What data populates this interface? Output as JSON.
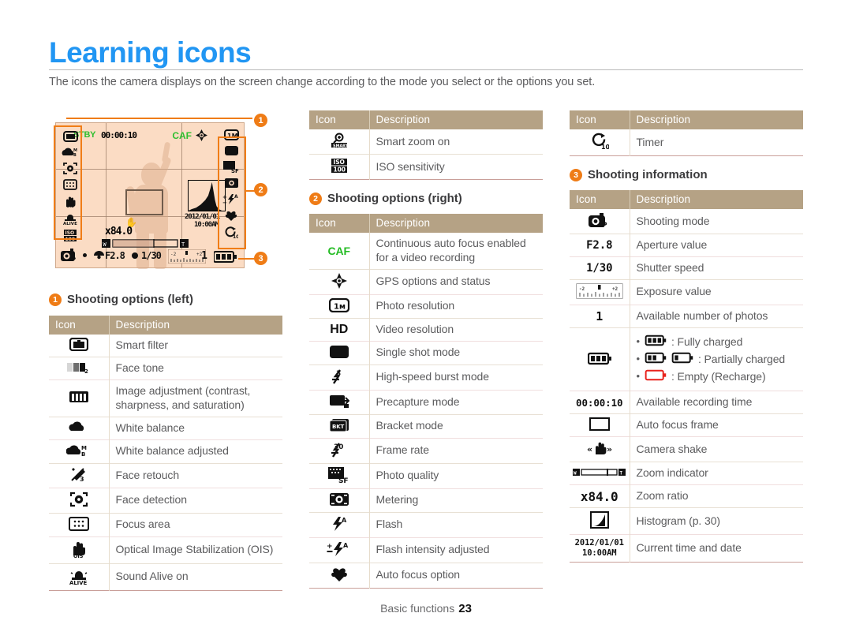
{
  "header": {
    "title": "Learning icons",
    "intro": "The icons the camera displays on the screen change according to the mode you select or the options you set."
  },
  "lcd": {
    "stby_label": "STBY",
    "rec_time": "00:00:10",
    "caf_label": "CAF",
    "zoom_ratio": "x84.0",
    "date_line1": "2012/01/01",
    "date_line2": "10:00AM",
    "aperture": "F2.8",
    "shutter": "1/30",
    "photos_left": "1",
    "ev_top": "-2      ▮      +2",
    "badges": {
      "one": "1",
      "two": "2",
      "three": "3"
    }
  },
  "columns": {
    "left": {
      "section": {
        "badge": "1",
        "title": "Shooting options (left)"
      },
      "table": {
        "headers": [
          "Icon",
          "Description"
        ],
        "rows": [
          {
            "icon": "smart-filter-icon",
            "desc": "Smart filter"
          },
          {
            "icon": "face-tone-icon",
            "desc": "Face tone"
          },
          {
            "icon": "image-adjustment-icon",
            "desc": "Image adjustment (contrast, sharpness, and saturation)"
          },
          {
            "icon": "white-balance-icon",
            "desc": "White balance"
          },
          {
            "icon": "white-balance-adjusted-icon",
            "desc": "White balance adjusted"
          },
          {
            "icon": "face-retouch-icon",
            "desc": "Face retouch"
          },
          {
            "icon": "face-detection-icon",
            "desc": "Face detection"
          },
          {
            "icon": "focus-area-icon",
            "desc": "Focus area"
          },
          {
            "icon": "ois-icon",
            "desc": "Optical Image Stabilization (OIS)"
          },
          {
            "icon": "sound-alive-icon",
            "desc": "Sound Alive on"
          }
        ]
      }
    },
    "middle": {
      "table_top": {
        "headers": [
          "Icon",
          "Description"
        ],
        "rows": [
          {
            "icon": "smart-zoom-icon",
            "desc": "Smart zoom on"
          },
          {
            "icon": "iso-icon",
            "desc": "ISO sensitivity"
          }
        ]
      },
      "section": {
        "badge": "2",
        "title": "Shooting options (right)"
      },
      "table": {
        "headers": [
          "Icon",
          "Description"
        ],
        "rows": [
          {
            "icon": "caf-icon",
            "icon_text": "CAF",
            "desc": "Continuous auto focus enabled for a video recording"
          },
          {
            "icon": "gps-icon",
            "desc": "GPS options and status"
          },
          {
            "icon": "photo-resolution-icon",
            "icon_text": "1M",
            "desc": "Photo resolution"
          },
          {
            "icon": "video-resolution-icon",
            "icon_text": "HD",
            "desc": "Video resolution"
          },
          {
            "icon": "single-shot-icon",
            "desc": "Single shot mode"
          },
          {
            "icon": "high-speed-burst-icon",
            "desc": "High-speed burst mode"
          },
          {
            "icon": "precapture-icon",
            "desc": "Precapture mode"
          },
          {
            "icon": "bracket-icon",
            "icon_text": "BKT",
            "desc": "Bracket mode"
          },
          {
            "icon": "frame-rate-icon",
            "icon_text": "30",
            "desc": "Frame rate"
          },
          {
            "icon": "photo-quality-icon",
            "icon_text": "SF",
            "desc": "Photo quality"
          },
          {
            "icon": "metering-icon",
            "desc": "Metering"
          },
          {
            "icon": "flash-icon",
            "desc": "Flash"
          },
          {
            "icon": "flash-intensity-icon",
            "desc": "Flash intensity adjusted"
          },
          {
            "icon": "auto-focus-option-icon",
            "desc": "Auto focus option"
          }
        ]
      }
    },
    "right": {
      "table_top": {
        "headers": [
          "Icon",
          "Description"
        ],
        "rows": [
          {
            "icon": "timer-icon",
            "desc": "Timer"
          }
        ]
      },
      "section": {
        "badge": "3",
        "title": "Shooting information"
      },
      "table": {
        "headers": [
          "Icon",
          "Description"
        ],
        "rows": [
          {
            "icon": "shooting-mode-icon",
            "desc": "Shooting mode"
          },
          {
            "icon": "aperture-icon",
            "icon_text": "F2.8",
            "desc": "Aperture value"
          },
          {
            "icon": "shutter-speed-icon",
            "icon_text": "1/30",
            "desc": "Shutter speed"
          },
          {
            "icon": "exposure-value-icon",
            "desc": "Exposure value"
          },
          {
            "icon": "photos-available-icon",
            "icon_text": "1",
            "desc": "Available number of photos"
          },
          {
            "icon": "battery-icon",
            "desc": "",
            "bullets": [
              {
                "label": ": Fully charged"
              },
              {
                "label": ": Partially charged"
              },
              {
                "label": ": Empty (Recharge)"
              }
            ]
          },
          {
            "icon": "recording-time-icon",
            "icon_text": "00:00:10",
            "desc": "Available recording time"
          },
          {
            "icon": "auto-focus-frame-icon",
            "desc": "Auto focus frame"
          },
          {
            "icon": "camera-shake-icon",
            "desc": "Camera shake"
          },
          {
            "icon": "zoom-indicator-icon",
            "desc": "Zoom indicator"
          },
          {
            "icon": "zoom-ratio-icon",
            "icon_text": "x84.0",
            "desc": "Zoom ratio"
          },
          {
            "icon": "histogram-icon",
            "desc": "Histogram (p. 30)"
          },
          {
            "icon": "date-time-icon",
            "icon_text_line1": "2012/01/01",
            "icon_text_line2": "10:00AM",
            "desc": "Current time and date"
          }
        ]
      }
    }
  },
  "footer": {
    "label": "Basic functions",
    "page": "23"
  }
}
